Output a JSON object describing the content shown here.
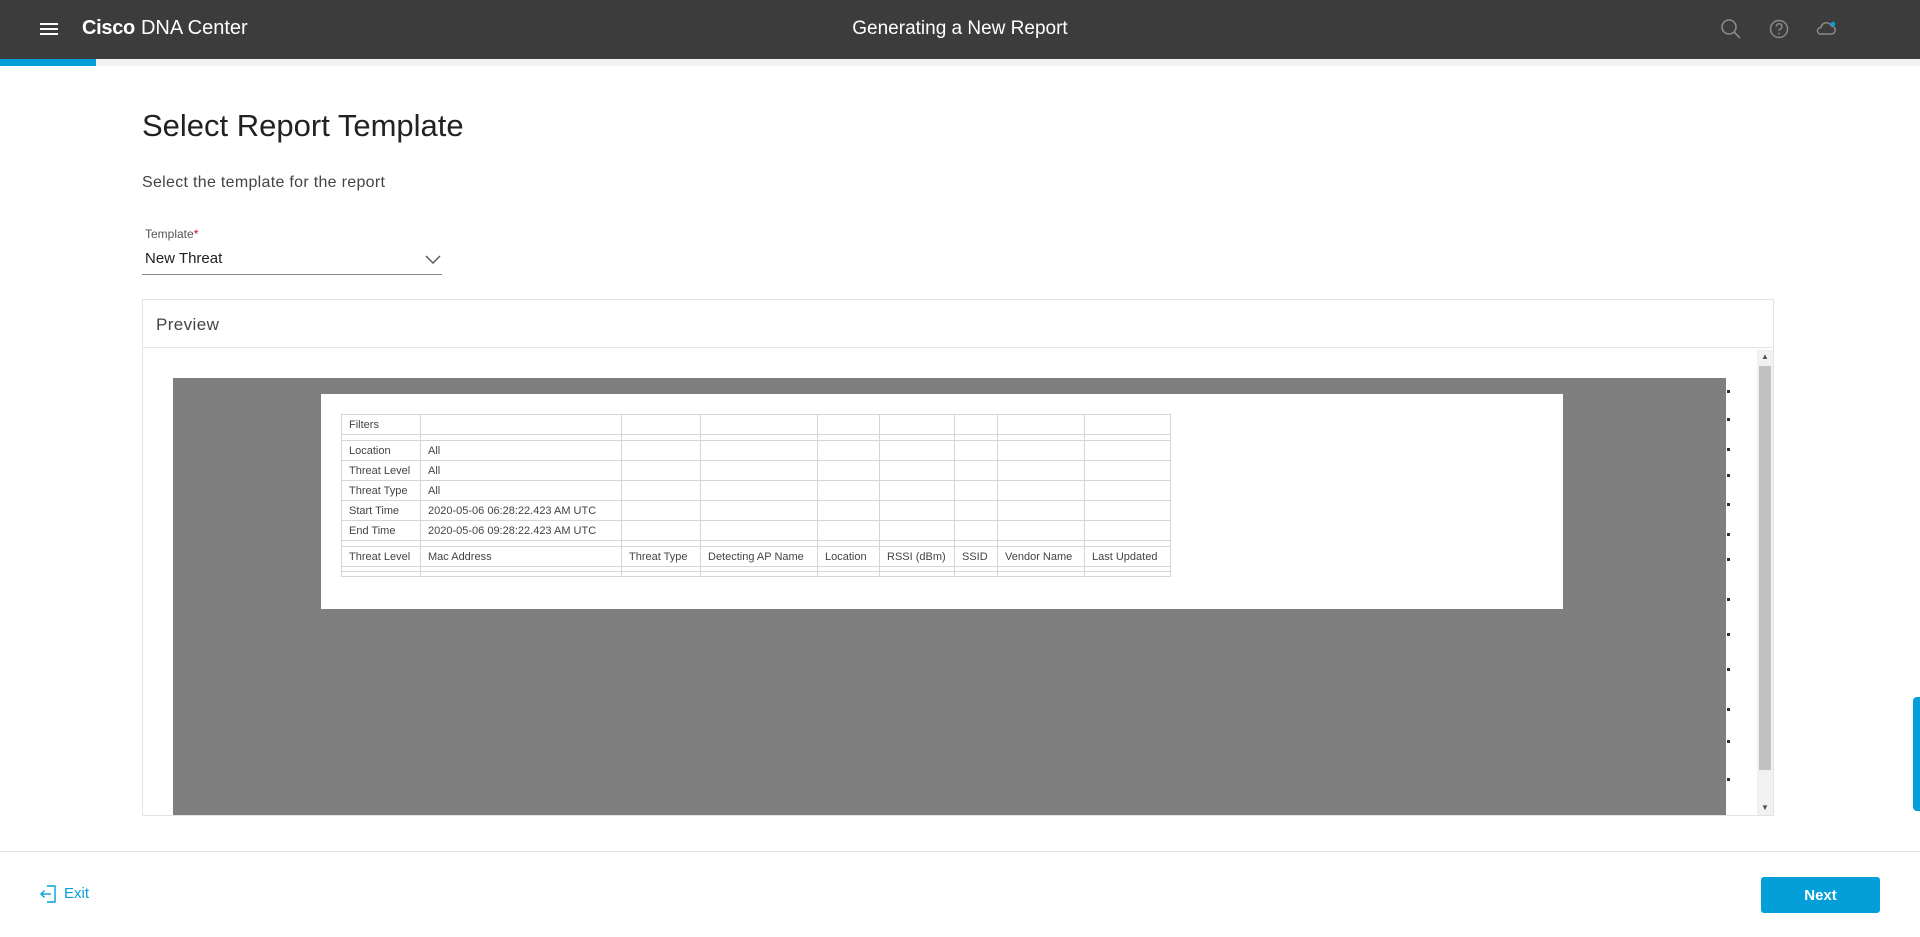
{
  "header": {
    "brand_bold": "Cisco",
    "brand_rest": "DNA Center",
    "window_title": "Generating a New Report",
    "icons": [
      "menu-icon",
      "search-icon",
      "help-icon",
      "cloud-icon"
    ],
    "progress_fraction": 0.05
  },
  "main": {
    "title": "Select Report Template",
    "subtitle": "Select the template for the report",
    "template_field": {
      "label": "Template",
      "required_mark": "*",
      "value": "New Threat"
    }
  },
  "preview": {
    "title": "Preview",
    "filters_header": "Filters",
    "filters": [
      {
        "label": "Location",
        "value": "All"
      },
      {
        "label": "Threat Level",
        "value": "All"
      },
      {
        "label": "Threat Type",
        "value": "All"
      },
      {
        "label": "Start Time",
        "value": "2020-05-06 06:28:22.423 AM UTC"
      },
      {
        "label": "End Time",
        "value": "2020-05-06 09:28:22.423 AM UTC"
      }
    ],
    "columns": [
      "Threat Level",
      "Mac Address",
      "Threat Type",
      "Detecting AP Name",
      "Location",
      "RSSI (dBm)",
      "SSID",
      "Vendor Name",
      "Last Updated"
    ]
  },
  "footer": {
    "exit_label": "Exit",
    "next_label": "Next"
  },
  "colors": {
    "topbar": "#3c3c3c",
    "accent": "#049fd9",
    "preview_background": "#7f7f7f"
  }
}
